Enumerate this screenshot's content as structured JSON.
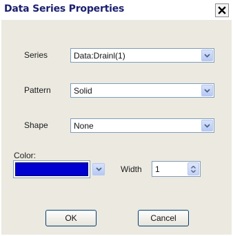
{
  "window": {
    "title": "Data Series Properties",
    "close_icon": "close-icon"
  },
  "form": {
    "series": {
      "label": "Series",
      "value": "Data:Drainl(1)"
    },
    "pattern": {
      "label": "Pattern",
      "value": "Solid"
    },
    "shape": {
      "label": "Shape",
      "value": "None"
    },
    "color": {
      "label": "Color:",
      "value_hex": "#0000d0"
    },
    "width": {
      "label": "Width",
      "value": "1"
    }
  },
  "buttons": {
    "ok_label": "OK",
    "cancel_label": "Cancel"
  },
  "colors": {
    "title_text": "#1a1f6e",
    "dialog_background": "#ebe9e0",
    "input_border": "#7f9db9",
    "dropdown_button": "#b6c9f4"
  }
}
